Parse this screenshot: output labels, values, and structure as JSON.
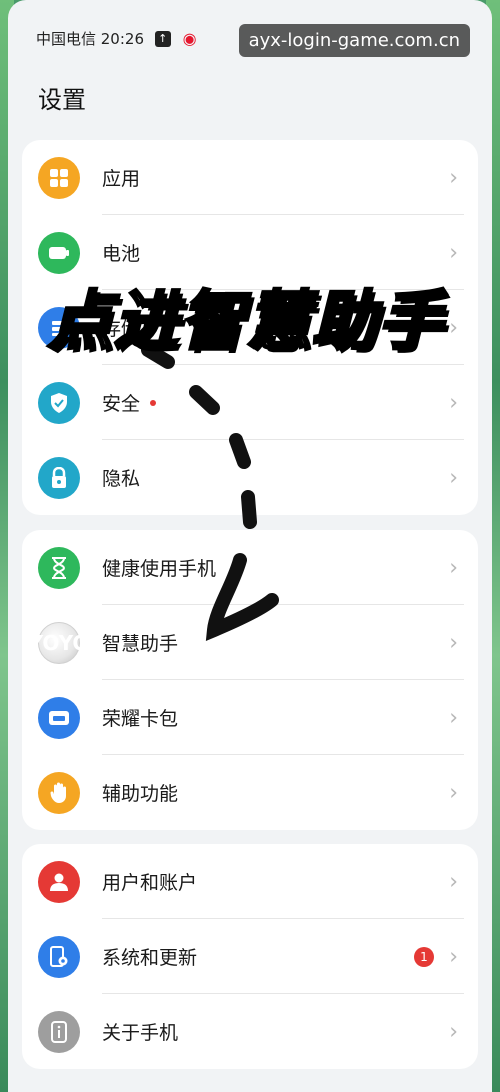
{
  "status": {
    "carrier_time": "中国电信 20:26",
    "watermark": "ayx-login-game.com.cn"
  },
  "page_title": "设置",
  "overlay_text": "点进智慧助手",
  "groups": [
    {
      "items": [
        {
          "label": "应用",
          "icon": "apps-icon",
          "color": "#f5a623",
          "glyph": "▦"
        },
        {
          "label": "电池",
          "icon": "battery-icon",
          "color": "#2eb85c",
          "glyph": "▬"
        },
        {
          "label": "存储",
          "icon": "storage-icon",
          "color": "#2f7ee8",
          "glyph": "≡"
        },
        {
          "label": "安全",
          "icon": "shield-icon",
          "color": "#22a7c9",
          "glyph": "✓",
          "dot": true
        },
        {
          "label": "隐私",
          "icon": "lock-icon",
          "color": "#22a7c9",
          "glyph": "🔒"
        }
      ]
    },
    {
      "items": [
        {
          "label": "健康使用手机",
          "icon": "hourglass-icon",
          "color": "#2eb85c",
          "glyph": "⌛"
        },
        {
          "label": "智慧助手",
          "icon": "yoyo-icon",
          "color": "#e6e6e6",
          "glyph": "YOYO"
        },
        {
          "label": "荣耀卡包",
          "icon": "wallet-icon",
          "color": "#2f7ee8",
          "glyph": "▭"
        },
        {
          "label": "辅助功能",
          "icon": "hand-icon",
          "color": "#f5a623",
          "glyph": "✋"
        }
      ]
    },
    {
      "items": [
        {
          "label": "用户和账户",
          "icon": "user-icon",
          "color": "#e53935",
          "glyph": "👤"
        },
        {
          "label": "系统和更新",
          "icon": "phone-settings-icon",
          "color": "#2f7ee8",
          "glyph": "⚙",
          "badge": "1"
        },
        {
          "label": "关于手机",
          "icon": "info-icon",
          "color": "#9e9e9e",
          "glyph": "ℹ"
        }
      ]
    }
  ]
}
